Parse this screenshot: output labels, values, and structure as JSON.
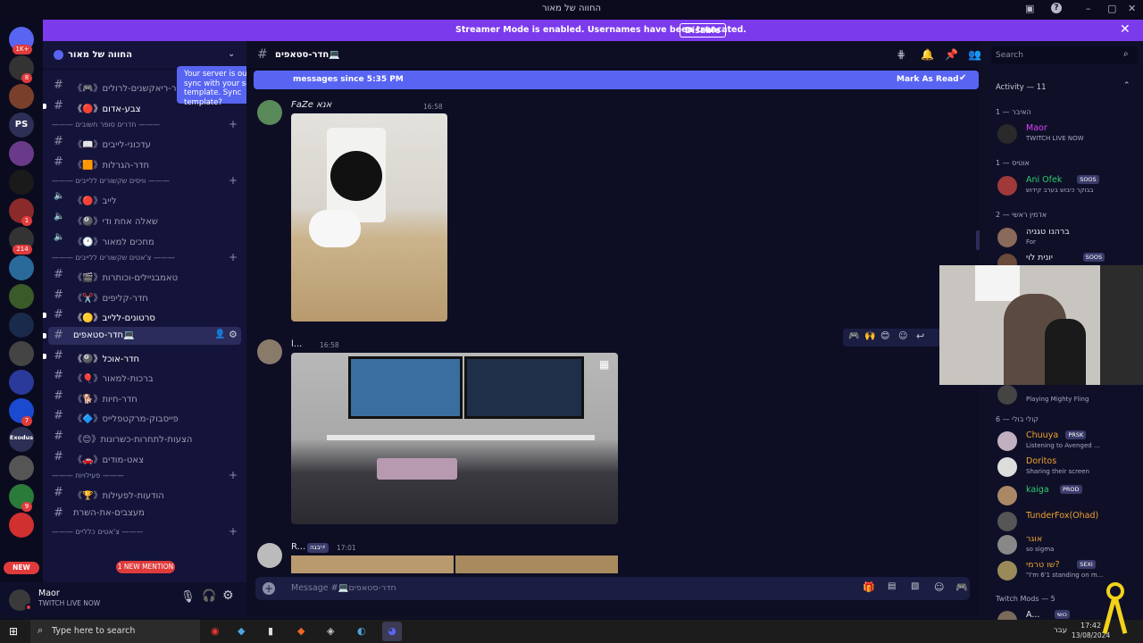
{
  "window": {
    "title": "החווה של מאור"
  },
  "banner": {
    "text": "Streamer Mode is enabled. Usernames have been truncated.",
    "button": "Disable",
    "color": "#7c3aed"
  },
  "server_rail": {
    "items": [
      {
        "label": "",
        "badge": "1K+"
      },
      {
        "label": "",
        "badge": "8"
      },
      {
        "label": "",
        "badge": ""
      },
      {
        "label": "PS",
        "badge": ""
      },
      {
        "label": "",
        "badge": ""
      },
      {
        "label": "",
        "badge": ""
      },
      {
        "label": "",
        "badge": "1"
      },
      {
        "label": "",
        "badge": "214"
      },
      {
        "label": "",
        "badge": ""
      },
      {
        "label": "",
        "badge": ""
      },
      {
        "label": "",
        "badge": ""
      },
      {
        "label": "",
        "badge": ""
      },
      {
        "label": "",
        "badge": ""
      },
      {
        "label": "",
        "badge": "7"
      },
      {
        "label": "Exodus",
        "badge": ""
      },
      {
        "label": "",
        "badge": ""
      },
      {
        "label": "",
        "badge": "9"
      },
      {
        "label": "",
        "badge": ""
      }
    ],
    "new_badge": "NEW"
  },
  "sidebar": {
    "server_name": "החווה של מאור",
    "tooltip": "Your server is out of sync with your server template. Sync template?",
    "new_mention": "1 NEW MENTION",
    "items": [
      {
        "type": "channel",
        "label": "《🎮》חדר-ריאקשנים-לרולים",
        "bold": false
      },
      {
        "type": "channel",
        "label": "《🔴》צבע-אדום",
        "bold": true
      },
      {
        "type": "category",
        "label": "——— חדרים סופר חשובים ———"
      },
      {
        "type": "channel",
        "label": "《📖》עדכוני-לייבים",
        "bold": false
      },
      {
        "type": "channel",
        "label": "《🟧》חדר-הגרלות",
        "bold": false
      },
      {
        "type": "category",
        "label": "——— וויסים שקשורים ללייבים ———"
      },
      {
        "type": "voice",
        "label": "《🔴》לייב",
        "bold": false
      },
      {
        "type": "voice",
        "label": "《🎱》שאלה אחת ודי",
        "bold": false
      },
      {
        "type": "voice",
        "label": "《🕐》מחכים למאור",
        "bold": false
      },
      {
        "type": "category",
        "label": "——— צ'אטים שקשורים ללייבים ———"
      },
      {
        "type": "channel",
        "label": "《🎬》טאמבניילים-וכותרות",
        "bold": false
      },
      {
        "type": "channel",
        "label": "《✂️》חדר-קליפים",
        "bold": false
      },
      {
        "type": "channel",
        "label": "《🟡》סרטונים-ללייב",
        "bold": true
      },
      {
        "type": "channel",
        "label": "חדר-סטאפים💻",
        "bold": true,
        "selected": true
      },
      {
        "type": "channel",
        "label": "《🎱》חדר-אוכל",
        "bold": true
      },
      {
        "type": "channel",
        "label": "《🎈》ברכות-למאור",
        "bold": false
      },
      {
        "type": "channel",
        "label": "《🐕》חדר-חיות",
        "bold": false
      },
      {
        "type": "channel",
        "label": "《🔷》פייסבוק-מרקטפלייס",
        "bold": false
      },
      {
        "type": "channel",
        "label": "《😊》הצעות-לתחרות-כשרונות",
        "bold": false
      },
      {
        "type": "channel",
        "label": "《🚗》צאט-מודים",
        "bold": false
      },
      {
        "type": "category",
        "label": "——— פעילויות ———"
      },
      {
        "type": "channel",
        "label": "《🏆》הודעות-לפעילות",
        "bold": false
      },
      {
        "type": "channel",
        "label": "מעצבים-את-השרת",
        "bold": false
      },
      {
        "type": "category",
        "label": "——— צ'אטים כלליים ———"
      }
    ]
  },
  "user_panel": {
    "name": "Maor",
    "status": "TWITCH LIVE NOW"
  },
  "channel_header": {
    "name": "חדר-סטאפים💻"
  },
  "unread_bar": {
    "text": "messages since 5:35 PM",
    "action": "Mark As Read"
  },
  "messages": [
    {
      "author": "FaZe אנא",
      "time": "16:58"
    },
    {
      "author": "l...",
      "time": "16:58"
    },
    {
      "author": "R...",
      "tag": "יבגה⚡",
      "time": "17:01"
    }
  ],
  "composer": {
    "placeholder": "Message #💻חדר-סטאפים"
  },
  "right_panel": {
    "search_placeholder": "Search",
    "activity": "Activity — 11",
    "sections": [
      {
        "title": "האיבר — 1"
      },
      {
        "title": "אוטיס — 1"
      },
      {
        "title": "אדמין ראשי — 2"
      },
      {
        "title": "קולי בולי — 6"
      },
      {
        "title": "Twitch Mods — 5"
      }
    ],
    "members": [
      {
        "name": "Maor",
        "status": "TWITCH LIVE NOW",
        "color": "#e040fb"
      },
      {
        "name": "Ani Ofek",
        "tag": "SOOS",
        "status": "בבוקר כיבוש בערב קידוש",
        "color": "#2ecc71"
      },
      {
        "name": "ברהנו טגניה",
        "status": "For",
        "color": "#e7e7f0"
      },
      {
        "name": "יונית לוי",
        "tag": "SOOS",
        "status": "",
        "color": "#e7e7f0"
      },
      {
        "name": "",
        "status": "Playing Mighty Fling",
        "color": "#e7e7f0"
      },
      {
        "name": "Chuuya",
        "tag": "PRSK",
        "status": "Listening to Avenged ...",
        "color": "#f0a030"
      },
      {
        "name": "Doritos",
        "status": "Sharing their screen",
        "color": "#f0a030"
      },
      {
        "name": "kaiga",
        "tag": "PROD",
        "status": "",
        "color": "#2ecc71"
      },
      {
        "name": "TunderFox(Ohad)",
        "status": "",
        "color": "#f0a030"
      },
      {
        "name": "אוגר",
        "status": "so sigma",
        "color": "#f0a030"
      },
      {
        "name": "שו טרמי?",
        "tag": "SEXI",
        "status": "\"I'm 6'1 standing on m...",
        "color": "#f0a030"
      },
      {
        "name": "A...",
        "tag": "כושי",
        "status": "",
        "color": "#e7e7f0"
      }
    ]
  },
  "taskbar": {
    "search_placeholder": "Type here to search",
    "lang": "עבר",
    "time": "17:42",
    "date": "13/08/2024"
  }
}
